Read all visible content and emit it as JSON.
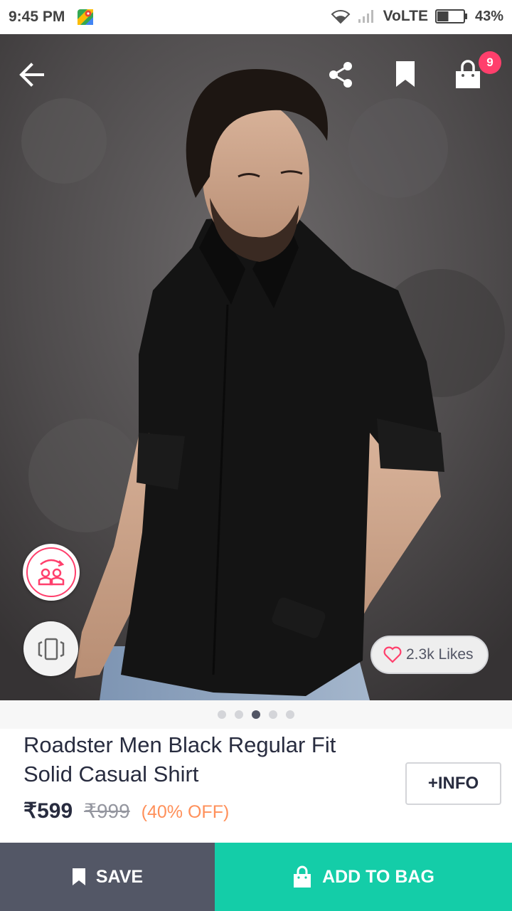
{
  "status_bar": {
    "time": "9:45 PM",
    "network": "VoLTE",
    "battery": "43%",
    "battery_level": 0.43
  },
  "header": {
    "cart_count": "9"
  },
  "product": {
    "likes": "2.3k Likes",
    "image_count": 5,
    "active_image": 3,
    "title": "Roadster Men Black Regular Fit Solid Casual Shirt",
    "info_label": "+INFO",
    "price": "₹599",
    "mrp": "₹999",
    "discount": "(40% OFF)"
  },
  "actions": {
    "save_label": "SAVE",
    "add_to_bag_label": "ADD TO BAG"
  },
  "colors": {
    "brand_pink": "#ff3f6c",
    "discount_orange": "#ff905a",
    "add_to_bag_teal": "#14cda8",
    "save_grey": "#535766"
  }
}
